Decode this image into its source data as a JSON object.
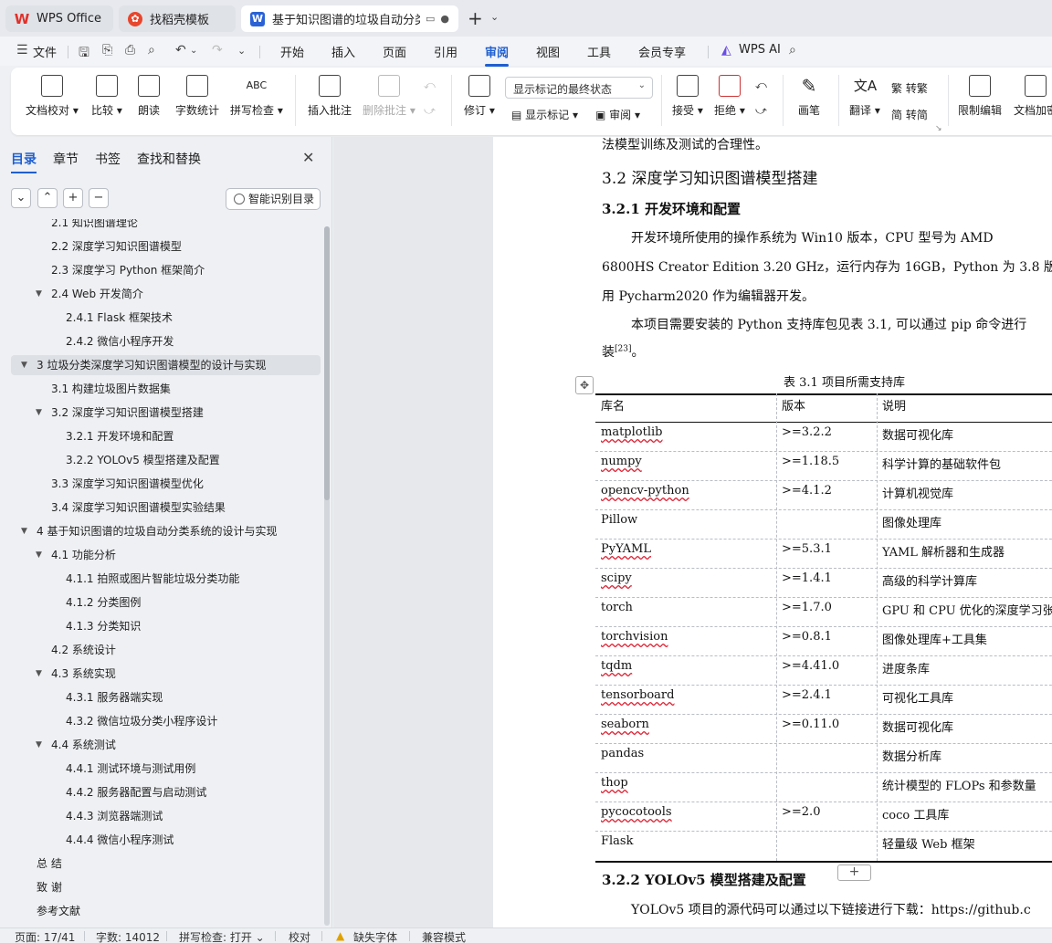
{
  "tabs": [
    {
      "label": "WPS Office",
      "icon": "wps-logo-icon"
    },
    {
      "label": "找稻壳模板",
      "icon": "docer-icon"
    },
    {
      "label": "基于知识图谱的垃圾自动分类",
      "icon": "writer-doc-icon"
    }
  ],
  "menu": {
    "file": "文件",
    "items": [
      "开始",
      "插入",
      "页面",
      "引用",
      "审阅",
      "视图",
      "工具",
      "会员专享"
    ],
    "active": "审阅",
    "ai": "WPS AI"
  },
  "ribbon": {
    "doc_check": "文档校对",
    "compare": "比较",
    "read_aloud": "朗读",
    "word_count": "字数统计",
    "spell_check": "拼写检查",
    "insert_comment": "插入批注",
    "delete_comment": "删除批注",
    "revise": "修订",
    "display_mode": "显示标记的最终状态",
    "show_markup": "显示标记",
    "review": "审阅",
    "accept": "接受",
    "reject": "拒绝",
    "pen": "画笔",
    "translate": "翻译",
    "to_traditional": "转繁",
    "to_simplified": "转简",
    "restrict_edit": "限制编辑",
    "doc_encrypt": "文档加密"
  },
  "panel": {
    "tabs": [
      "目录",
      "章节",
      "书签",
      "查找和替换"
    ],
    "active_tab": "目录",
    "smart_toc": "智能识别目录",
    "toc": [
      {
        "label": "2.1  知识图谱理论",
        "level": 2,
        "arrow": false
      },
      {
        "label": "2.2  深度学习知识图谱模型",
        "level": 2,
        "arrow": false
      },
      {
        "label": "2.3  深度学习 Python 框架简介",
        "level": 2,
        "arrow": false
      },
      {
        "label": "2.4 Web 开发简介",
        "level": 2,
        "arrow": true
      },
      {
        "label": "2.4.1 Flask 框架技术",
        "level": 3,
        "arrow": false
      },
      {
        "label": "2.4.2  微信小程序开发",
        "level": 3,
        "arrow": false
      },
      {
        "label": "3  垃圾分类深度学习知识图谱模型的设计与实现",
        "level": 1,
        "arrow": true,
        "selected": true
      },
      {
        "label": "3.1  构建垃圾图片数据集",
        "level": 2,
        "arrow": false
      },
      {
        "label": "3.2  深度学习知识图谱模型搭建",
        "level": 2,
        "arrow": true
      },
      {
        "label": "3.2.1  开发环境和配置",
        "level": 3,
        "arrow": false
      },
      {
        "label": "3.2.2 YOLOv5 模型搭建及配置",
        "level": 3,
        "arrow": false
      },
      {
        "label": "3.3  深度学习知识图谱模型优化",
        "level": 2,
        "arrow": false
      },
      {
        "label": "3.4  深度学习知识图谱模型实验结果",
        "level": 2,
        "arrow": false
      },
      {
        "label": "4  基于知识图谱的垃圾自动分类系统的设计与实现",
        "level": 1,
        "arrow": true
      },
      {
        "label": "4.1  功能分析",
        "level": 2,
        "arrow": true
      },
      {
        "label": "4.1.1  拍照或图片智能垃圾分类功能",
        "level": 3,
        "arrow": false
      },
      {
        "label": "4.1.2  分类图例",
        "level": 3,
        "arrow": false
      },
      {
        "label": "4.1.3  分类知识",
        "level": 3,
        "arrow": false
      },
      {
        "label": "4.2  系统设计",
        "level": 2,
        "arrow": false
      },
      {
        "label": "4.3  系统实现",
        "level": 2,
        "arrow": true
      },
      {
        "label": "4.3.1  服务器端实现",
        "level": 3,
        "arrow": false
      },
      {
        "label": "4.3.2  微信垃圾分类小程序设计",
        "level": 3,
        "arrow": false
      },
      {
        "label": "4.4  系统测试",
        "level": 2,
        "arrow": true
      },
      {
        "label": "4.4.1  测试环境与测试用例",
        "level": 3,
        "arrow": false
      },
      {
        "label": "4.4.2  服务器配置与启动测试",
        "level": 3,
        "arrow": false
      },
      {
        "label": "4.4.3  浏览器端测试",
        "level": 3,
        "arrow": false
      },
      {
        "label": "4.4.4  微信小程序测试",
        "level": 3,
        "arrow": false
      },
      {
        "label": "总  结",
        "level": 0,
        "arrow": false
      },
      {
        "label": "致  谢",
        "level": 0,
        "arrow": false
      },
      {
        "label": "参考文献",
        "level": 0,
        "arrow": false
      }
    ]
  },
  "document": {
    "line_top": "法模型训练及测试的合理性。",
    "h_3_2": "3.2  深度学习知识图谱模型搭建",
    "h_3_2_1": "3.2.1  开发环境和配置",
    "p1_l1": "开发环境所使用的操作系统为 Win10 版本，CPU 型号为 AMD",
    "p1_l2": "6800HS Creator Edition    3.20 GHz，运行内存为 16GB，Python 为 3.8 版",
    "p1_l3": "用 Pycharm2020 作为编辑器开发。",
    "p2_l1": "本项目需要安装的 Python 支持库包见表 3.1, 可以通过 pip 命令进行",
    "p2_l2": "装",
    "p2_sup": "[23]",
    "p2_end": "。",
    "table_caption": "表 3.1    项目所需支持库",
    "table_headers": [
      "库名",
      "版本",
      "说明"
    ],
    "table_rows": [
      [
        "matplotlib",
        ">=3.2.2",
        "数据可视化库"
      ],
      [
        "numpy",
        ">=1.18.5",
        "科学计算的基础软件包"
      ],
      [
        "opencv-python",
        ">=4.1.2",
        "计算机视觉库"
      ],
      [
        "Pillow",
        "",
        "图像处理库"
      ],
      [
        "PyYAML",
        ">=5.3.1",
        "YAML 解析器和生成器"
      ],
      [
        "scipy",
        ">=1.4.1",
        "高级的科学计算库"
      ],
      [
        "torch",
        ">=1.7.0",
        "GPU 和 CPU 优化的深度学习张"
      ],
      [
        "torchvision",
        ">=0.8.1",
        "图像处理库+工具集"
      ],
      [
        "tqdm",
        ">=4.41.0",
        "进度条库"
      ],
      [
        "tensorboard",
        ">=2.4.1",
        "可视化工具库"
      ],
      [
        "seaborn",
        ">=0.11.0",
        "数据可视化库"
      ],
      [
        "pandas",
        "",
        "数据分析库"
      ],
      [
        "thop",
        "",
        "统计模型的  FLOPs  和参数量"
      ],
      [
        "pycocotools",
        ">=2.0",
        "coco 工具库"
      ],
      [
        "Flask",
        "",
        "轻量级 Web 框架"
      ]
    ],
    "h_3_2_2": "3.2.2 YOLOv5 模型搭建及配置",
    "p3": "YOLOv5 项目的源代码可以通过以下链接进行下载：https://github.c"
  },
  "status": {
    "page": "页面: 17/41",
    "words": "字数: 14012",
    "spell": "拼写检查: 打开",
    "proof": "校对",
    "missing_font": "缺失字体",
    "compat": "兼容模式"
  }
}
